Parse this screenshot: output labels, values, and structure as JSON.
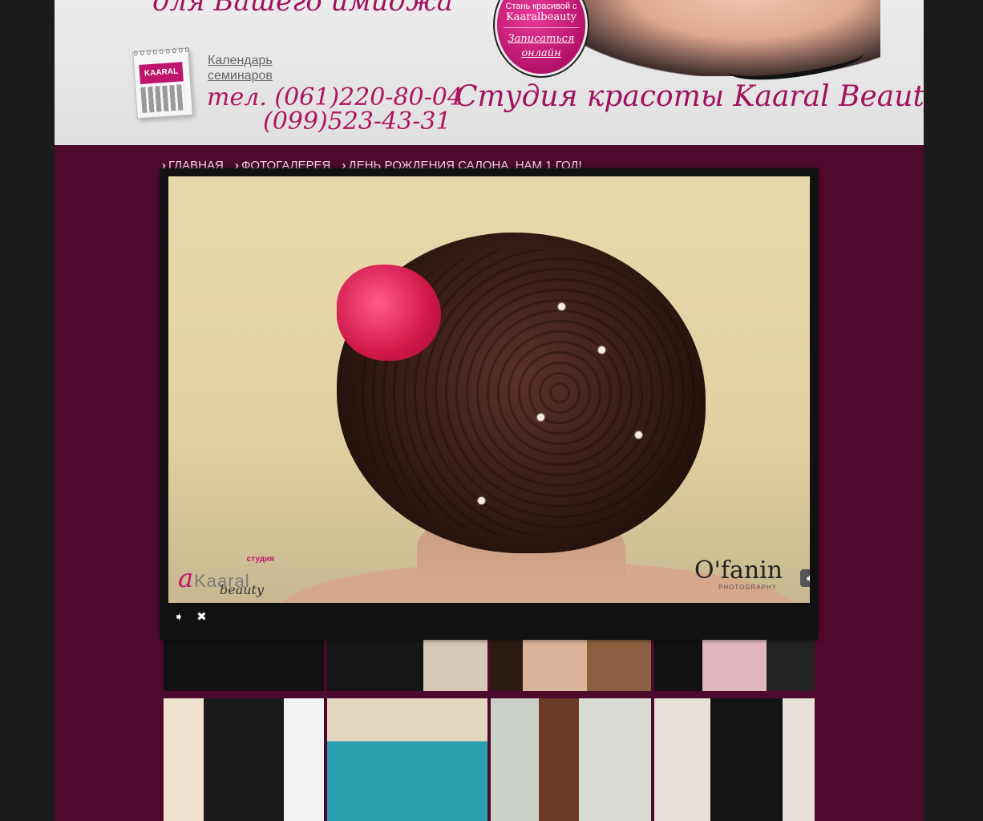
{
  "header": {
    "slogan": "для Вашего имиджа",
    "calendar_link": [
      "Календарь",
      "семинаров"
    ],
    "phone_1": "тел. (061)220-80-04",
    "phone_2": "(099)523-43-31",
    "badge": {
      "line_1": "Стань красивой с",
      "line_2": "Kaaralbeauty",
      "signup_link": [
        "Записаться",
        "онлайн"
      ]
    },
    "studio_name": "Студия красоты Kaaral Beauty"
  },
  "breadcrumb": [
    "ГЛАВНАЯ",
    "ФОТОГАЛЕРЕЯ",
    "ДЕНЬ РОЖДЕНИЯ САЛОНА, НАМ 1 ГОД!"
  ],
  "lightbox": {
    "watermark_left": {
      "top": "студия",
      "brand": "Kaaral",
      "sub": "beauty"
    },
    "watermark_right": {
      "name": "O'fanin",
      "sub": "PHOTOGRAPHY"
    },
    "icons": {
      "next": "next-arrow-icon",
      "play": "play-slideshow-icon",
      "close": "close-icon"
    }
  },
  "colors": {
    "brand_pink": "#b0145f",
    "page_bg": "#4d0a2c",
    "outer_bg": "#1b1b1b"
  }
}
